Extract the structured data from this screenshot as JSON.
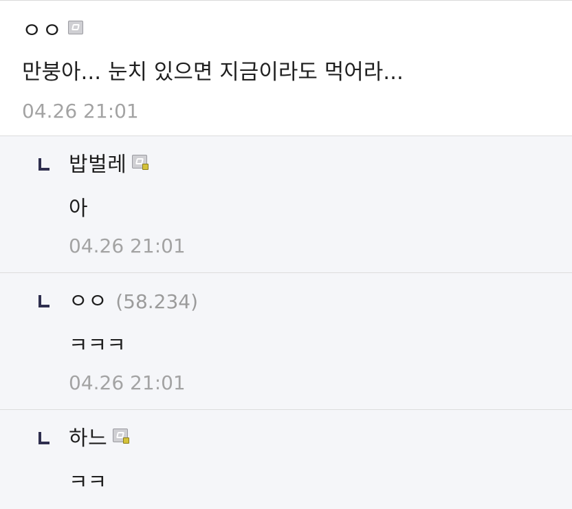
{
  "main_comment": {
    "author": "ㅇㅇ",
    "body": "만붕아... 눈치 있으면 지금이라도 먹어라...",
    "date": "04.26 21:01"
  },
  "replies": [
    {
      "author": "밥벌레",
      "body": "아",
      "date": "04.26 21:01"
    },
    {
      "author": "ㅇㅇ",
      "ip": "(58.234)",
      "body": "ㅋㅋㅋ",
      "date": "04.26 21:01"
    },
    {
      "author": "하느",
      "body": "ㅋㅋ"
    }
  ],
  "icons": {
    "member": "member-badge-icon",
    "reply": "reply-arrow-icon"
  },
  "colors": {
    "reply_background": "#f5f6f9",
    "date_text": "#a3a3a3",
    "ip_text": "#9b9b9b",
    "reply_arrow": "#2f2f4f"
  }
}
